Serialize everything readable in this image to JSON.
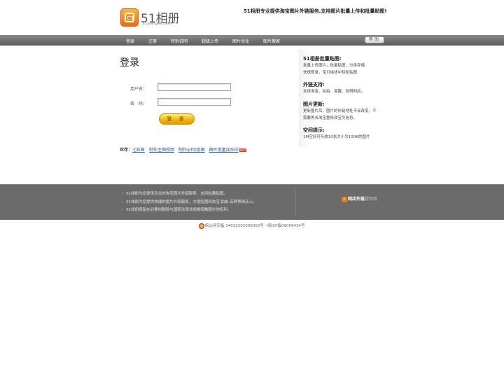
{
  "header": {
    "logo_text": "51相册",
    "logo_sub": "51xiangce.com",
    "slogan": "51相册专业提供淘宝图片外链服务,支持图片批量上传和批量贴图!"
  },
  "nav": {
    "items": [
      "登录",
      "注册",
      "特别说明",
      "超级上传",
      "图片优化",
      "图片搬家"
    ],
    "help": "帮助"
  },
  "login": {
    "title": "登录",
    "username_label": "用户名：",
    "password_label": "密　码：",
    "username_value": "",
    "password_value": "",
    "submit_label": "登 录"
  },
  "partners": {
    "label": "伙伴：",
    "links": [
      "七彩鱼",
      "制作主图视频",
      "制作gif动态图",
      "图片批量加水印"
    ],
    "badge": "HOT"
  },
  "info": [
    {
      "title": "51相册批量贴图:",
      "lines": [
        "批量上传图片，批量贴图，分类存储",
        "快速登录，宝贝描述中轻松贴图"
      ]
    },
    {
      "title": "外链支持:",
      "lines": [
        "支持淘宝、拍拍、易趣、有啊网店。"
      ]
    },
    {
      "title": "图片更新:",
      "lines": [
        "更新图片后，图片的外链地址不会改变，不",
        "需要再去淘宝重修改宝贝信息。"
      ]
    },
    {
      "title": "空间提示:",
      "lines": [
        "1M空间可存放10张大小为100K的图片"
      ]
    }
  ],
  "footer": {
    "lines": [
      "51相册为您提供专业的淘宝图片外链服务，支持批量贴图。",
      "51相册为您提供快捷的图片外链服务，方便贴图到淘宝,拍拍,有啊等网店上。",
      "51相册保留在必要时删除与国家法律法规相抵触图片的权利。"
    ],
    "ad_main": "网店外链",
    "ad_sub": "提供商",
    "icp": "皖公网安备 34032202000002号 - 皖ICP备09009434号"
  },
  "colors": {
    "accent": "#f26a07",
    "nav_bg": "#6f6f6f",
    "footer_bg": "#6b6b6b",
    "link": "#1a55b0"
  }
}
